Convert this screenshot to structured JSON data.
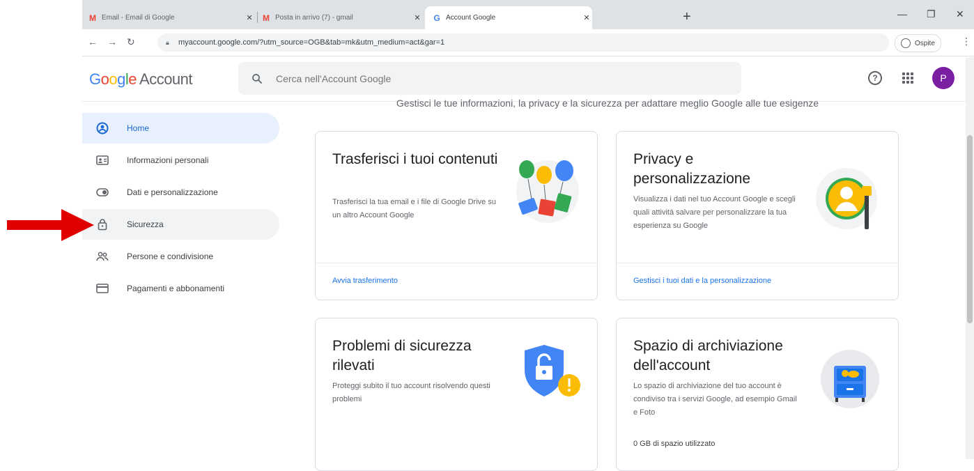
{
  "browser": {
    "tabs": [
      {
        "title": "Email - Email di Google"
      },
      {
        "title": "Posta in arrivo (7) - gmail"
      },
      {
        "title": "Account Google"
      }
    ],
    "url": "myaccount.google.com/?utm_source=OGB&tab=mk&utm_medium=act&gar=1",
    "profile_label": "Ospite"
  },
  "header": {
    "logo_google": "Google",
    "logo_account": "Account",
    "search_placeholder": "Cerca nell'Account Google",
    "avatar_initial": "P"
  },
  "sidebar": {
    "items": [
      {
        "label": "Home"
      },
      {
        "label": "Informazioni personali"
      },
      {
        "label": "Dati e personalizzazione"
      },
      {
        "label": "Sicurezza"
      },
      {
        "label": "Persone e condivisione"
      },
      {
        "label": "Pagamenti e abbonamenti"
      }
    ]
  },
  "main": {
    "subtitle": "Gestisci le tue informazioni, la privacy e la sicurezza per adattare meglio Google alle tue esigenze",
    "cards": [
      {
        "title": "Trasferisci i tuoi contenuti",
        "description": "Trasferisci la tua email e i file di Google Drive su un altro Account Google",
        "link": "Avvia trasferimento"
      },
      {
        "title": "Privacy e personalizzazione",
        "description": "Visualizza i dati nel tuo Account Google e scegli quali attività salvare per personalizzare la tua esperienza su Google",
        "link": "Gestisci i tuoi dati e la personalizzazione"
      },
      {
        "title": "Problemi di sicurezza rilevati",
        "description": "Proteggi subito il tuo account risolvendo questi problemi"
      },
      {
        "title": "Spazio di archiviazione dell'account",
        "description": "Lo spazio di archiviazione del tuo account è condiviso tra i servizi Google, ad esempio Gmail e Foto",
        "storage": "0 GB di spazio utilizzato"
      }
    ]
  },
  "colors": {
    "accent": "#1a73e8",
    "active_nav_bg": "#e8f0fe",
    "annotation_arrow": "#e00000",
    "avatar": "#7b1fa2"
  }
}
